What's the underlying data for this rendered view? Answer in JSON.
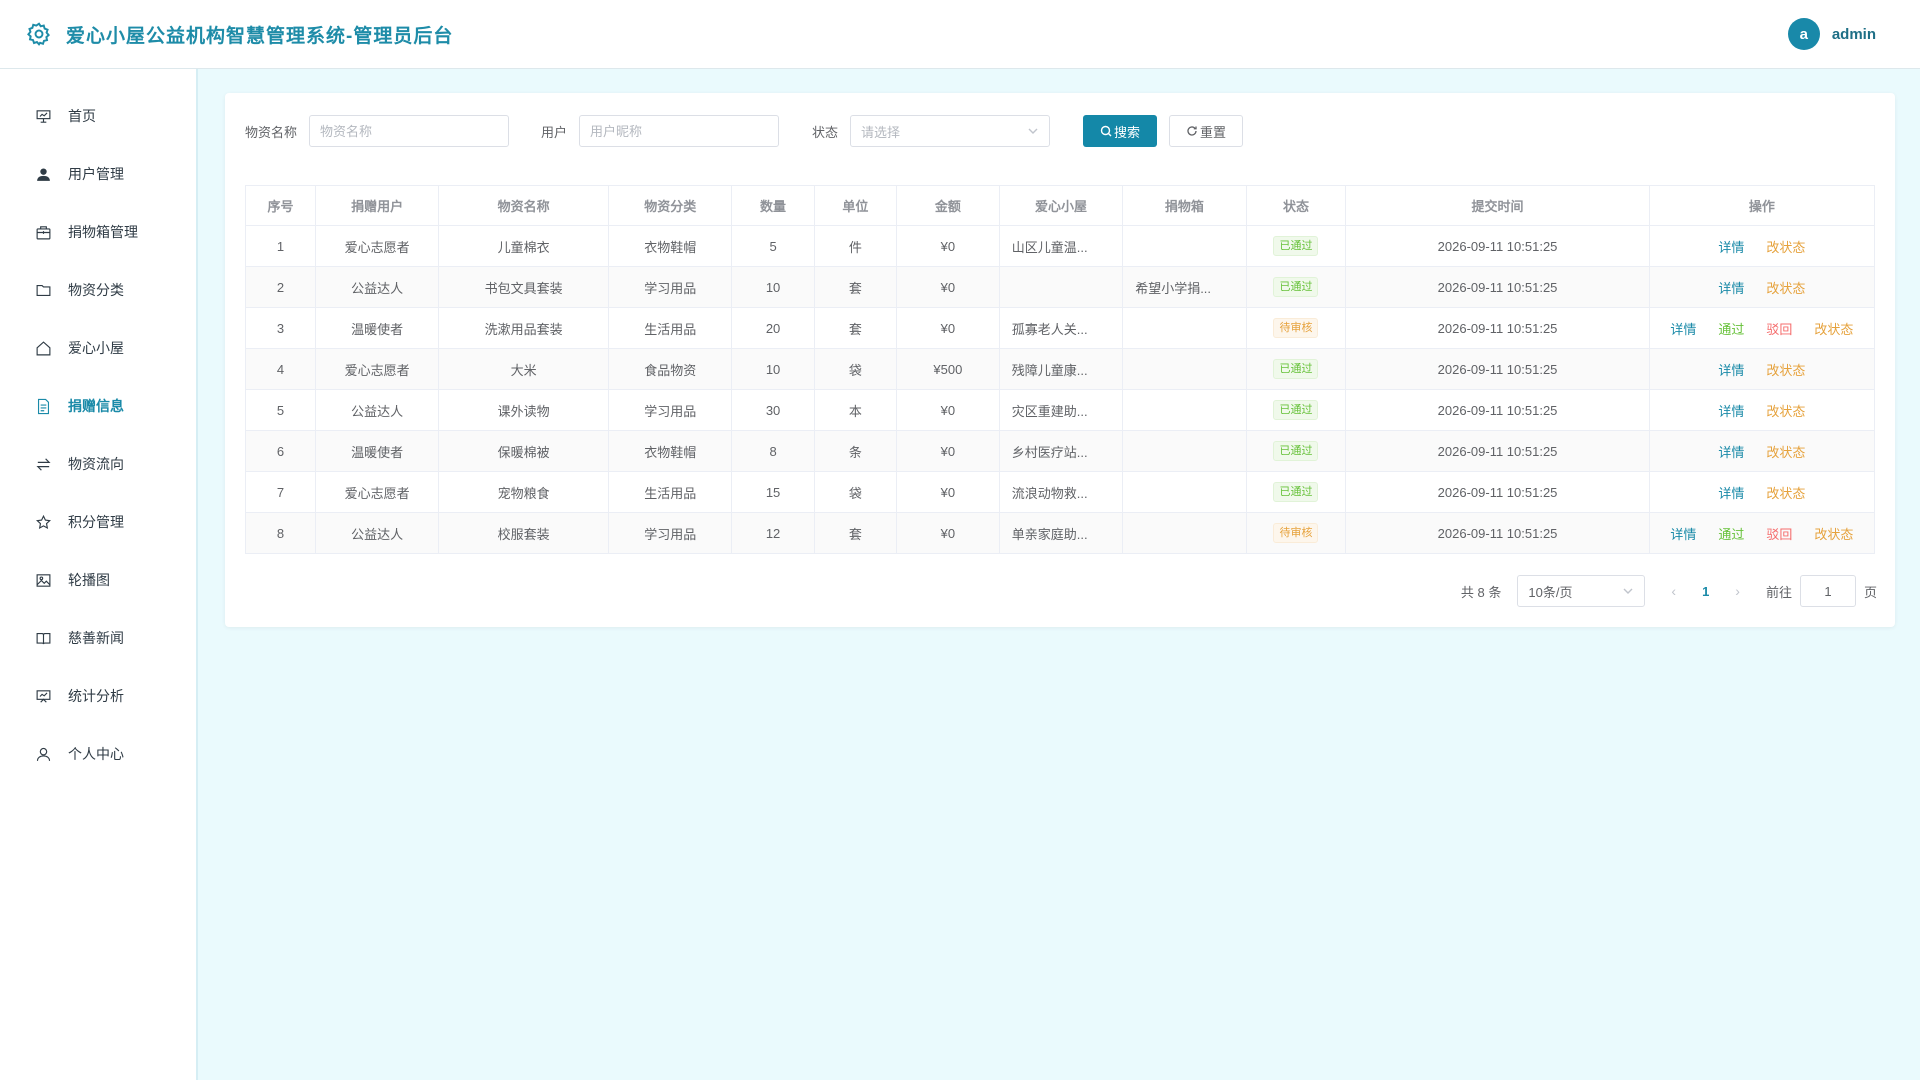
{
  "header": {
    "title": "爱心小屋公益机构智慧管理系统-管理员后台",
    "avatar_letter": "a",
    "username": "admin"
  },
  "sidebar": {
    "items": [
      {
        "label": "首页",
        "icon": "presentation-icon"
      },
      {
        "label": "用户管理",
        "icon": "user-icon"
      },
      {
        "label": "捐物箱管理",
        "icon": "box-icon"
      },
      {
        "label": "物资分类",
        "icon": "folder-icon"
      },
      {
        "label": "爱心小屋",
        "icon": "home-icon"
      },
      {
        "label": "捐赠信息",
        "icon": "document-icon",
        "active": true
      },
      {
        "label": "物资流向",
        "icon": "sort-icon"
      },
      {
        "label": "积分管理",
        "icon": "star-icon"
      },
      {
        "label": "轮播图",
        "icon": "picture-icon"
      },
      {
        "label": "慈善新闻",
        "icon": "book-icon"
      },
      {
        "label": "统计分析",
        "icon": "data-board-icon"
      },
      {
        "label": "个人中心",
        "icon": "user-outline-icon"
      }
    ]
  },
  "filters": {
    "name_label": "物资名称",
    "name_placeholder": "物资名称",
    "user_label": "用户",
    "user_placeholder": "用户昵称",
    "status_label": "状态",
    "status_placeholder": "请选择",
    "search_label": "搜索",
    "reset_label": "重置"
  },
  "table": {
    "columns": [
      "序号",
      "捐赠用户",
      "物资名称",
      "物资分类",
      "数量",
      "单位",
      "金额",
      "爱心小屋",
      "捐物箱",
      "状态",
      "提交时间",
      "操作"
    ],
    "rows": [
      {
        "no": "1",
        "user": "爱心志愿者",
        "name": "儿童棉衣",
        "category": "衣物鞋帽",
        "qty": "5",
        "unit": "件",
        "amount": "¥0",
        "house": "山区儿童温...",
        "box": "",
        "status": "已通过",
        "status_type": "ok",
        "time": "2026-09-11 10:51:25"
      },
      {
        "no": "2",
        "user": "公益达人",
        "name": "书包文具套装",
        "category": "学习用品",
        "qty": "10",
        "unit": "套",
        "amount": "¥0",
        "house": "",
        "box": "希望小学捐...",
        "status": "已通过",
        "status_type": "ok",
        "time": "2026-09-11 10:51:25"
      },
      {
        "no": "3",
        "user": "温暖使者",
        "name": "洗漱用品套装",
        "category": "生活用品",
        "qty": "20",
        "unit": "套",
        "amount": "¥0",
        "house": "孤寡老人关...",
        "box": "",
        "status": "待审核",
        "status_type": "pending",
        "time": "2026-09-11 10:51:25"
      },
      {
        "no": "4",
        "user": "爱心志愿者",
        "name": "大米",
        "category": "食品物资",
        "qty": "10",
        "unit": "袋",
        "amount": "¥500",
        "house": "残障儿童康...",
        "box": "",
        "status": "已通过",
        "status_type": "ok",
        "time": "2026-09-11 10:51:25"
      },
      {
        "no": "5",
        "user": "公益达人",
        "name": "课外读物",
        "category": "学习用品",
        "qty": "30",
        "unit": "本",
        "amount": "¥0",
        "house": "灾区重建助...",
        "box": "",
        "status": "已通过",
        "status_type": "ok",
        "time": "2026-09-11 10:51:25"
      },
      {
        "no": "6",
        "user": "温暖使者",
        "name": "保暖棉被",
        "category": "衣物鞋帽",
        "qty": "8",
        "unit": "条",
        "amount": "¥0",
        "house": "乡村医疗站...",
        "box": "",
        "status": "已通过",
        "status_type": "ok",
        "time": "2026-09-11 10:51:25"
      },
      {
        "no": "7",
        "user": "爱心志愿者",
        "name": "宠物粮食",
        "category": "生活用品",
        "qty": "15",
        "unit": "袋",
        "amount": "¥0",
        "house": "流浪动物救...",
        "box": "",
        "status": "已通过",
        "status_type": "ok",
        "time": "2026-09-11 10:51:25"
      },
      {
        "no": "8",
        "user": "公益达人",
        "name": "校服套装",
        "category": "学习用品",
        "qty": "12",
        "unit": "套",
        "amount": "¥0",
        "house": "单亲家庭助...",
        "box": "",
        "status": "待审核",
        "status_type": "pending",
        "time": "2026-09-11 10:51:25"
      }
    ],
    "ops": {
      "detail": "详情",
      "pass": "通过",
      "reject": "驳回",
      "change_status": "改状态"
    }
  },
  "pagination": {
    "total_text": "共 8 条",
    "page_size": "10条/页",
    "current_page": "1",
    "goto_label": "前往",
    "goto_value": "1",
    "page_suffix": "页"
  },
  "colors": {
    "primary": "#1488a8",
    "background": "#eafafd",
    "success": "#67c23a",
    "warning": "#e6a23c",
    "danger": "#f56c6c"
  }
}
